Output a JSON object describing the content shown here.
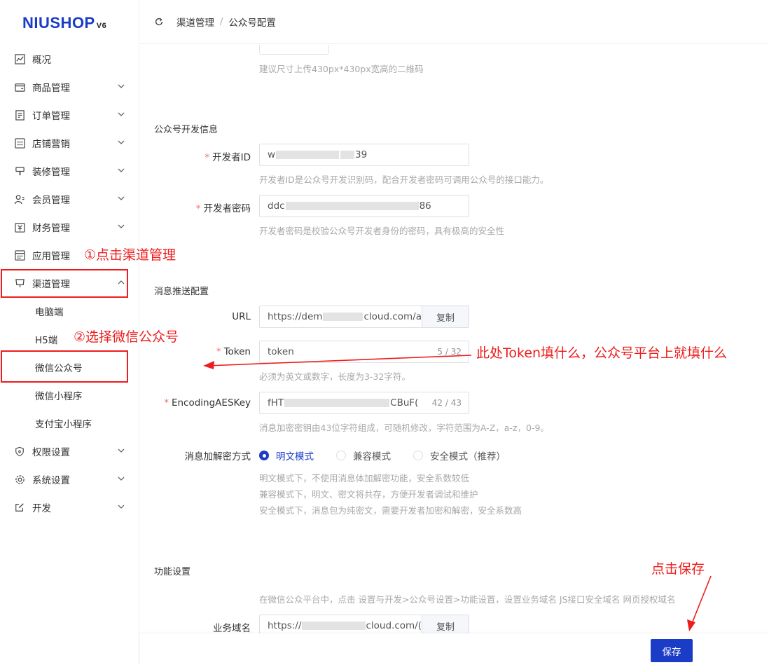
{
  "brand": {
    "logo_text": "NIUSHOP",
    "logo_version": "V6"
  },
  "sidebar": {
    "items": [
      {
        "label": "概况",
        "icon": "chart-line-icon"
      },
      {
        "label": "商品管理",
        "icon": "wallet-icon"
      },
      {
        "label": "订单管理",
        "icon": "order-list-icon"
      },
      {
        "label": "店铺营销",
        "icon": "grid-dots-icon"
      },
      {
        "label": "装修管理",
        "icon": "paint-icon"
      },
      {
        "label": "会员管理",
        "icon": "user-list-icon"
      },
      {
        "label": "财务管理",
        "icon": "finance-icon"
      },
      {
        "label": "应用管理",
        "icon": "app-grid-icon"
      },
      {
        "label": "渠道管理",
        "icon": "monitor-icon"
      },
      {
        "label": "权限设置",
        "icon": "shield-icon"
      },
      {
        "label": "系统设置",
        "icon": "gear-icon"
      },
      {
        "label": "开发",
        "icon": "edit-icon"
      }
    ],
    "channel_sub": [
      "电脑端",
      "H5端",
      "微信公众号",
      "微信小程序",
      "支付宝小程序"
    ]
  },
  "header": {
    "breadcrumb_parent": "渠道管理",
    "breadcrumb_sep": "/",
    "breadcrumb_current": "公众号配置"
  },
  "form": {
    "qr_hint": "建议尺寸上传430px*430px宽高的二维码",
    "dev_section": "公众号开发信息",
    "app_id": {
      "label": "开发者ID",
      "value_start": "w",
      "value_end": "39",
      "hint": "开发者ID是公众号开发识别码，配合开发者密码可调用公众号的接口能力。"
    },
    "app_secret": {
      "label": "开发者密码",
      "value_start": "ddc",
      "value_end": "86",
      "hint": "开发者密码是校验公众号开发者身份的密码，具有极高的安全性"
    },
    "push_section": "消息推送配置",
    "url": {
      "label": "URL",
      "value_start": "https://dem",
      "value_end": "cloud.com/a",
      "copy": "复制"
    },
    "token": {
      "label": "Token",
      "value": "token",
      "count": "5 / 32",
      "hint": "必须为英文或数字，长度为3-32字符。"
    },
    "aes_key": {
      "label": "EncodingAESKey",
      "value_start": "fHT",
      "value_end": "CBuF(",
      "count": "42 / 43",
      "hint": "消息加密密钥由43位字符组成，可随机修改，字符范围为A-Z，a-z，0-9。"
    },
    "encrypt": {
      "label": "消息加解密方式",
      "options": [
        "明文模式",
        "兼容模式",
        "安全模式（推荐）"
      ],
      "hints": [
        "明文模式下，不使用消息体加解密功能，安全系数较低",
        "兼容模式下，明文、密文将共存，方便开发者调试和维护",
        "安全模式下，消息包为纯密文，需要开发者加密和解密，安全系数高"
      ]
    },
    "func_section": "功能设置",
    "func_hint": "在微信公众平台中，点击 设置与开发>公众号设置>功能设置，设置业务域名 JS接口安全域名 网页授权域名",
    "biz_domain": {
      "label": "业务域名",
      "value_start": "https://",
      "value_end": "cloud.com/(",
      "copy": "复制"
    }
  },
  "footer": {
    "save": "保存"
  },
  "annotations": {
    "step1": "①点击渠道管理",
    "step2": "②选择微信公众号",
    "token_note": "此处Token填什么，公众号平台上就填什么",
    "save_note": "点击保存"
  }
}
